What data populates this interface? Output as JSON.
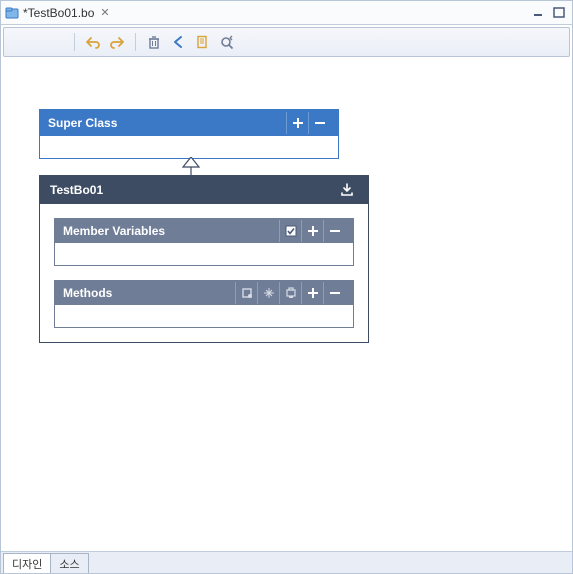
{
  "titlebar": {
    "file": "*TestBo01.bo"
  },
  "canvas": {
    "super": {
      "title": "Super Class"
    },
    "main": {
      "title": "TestBo01"
    },
    "sections": {
      "memberVariables": {
        "title": "Member Variables"
      },
      "methods": {
        "title": "Methods"
      }
    }
  },
  "bottomTabs": {
    "design": "디자인",
    "source": "소스"
  }
}
